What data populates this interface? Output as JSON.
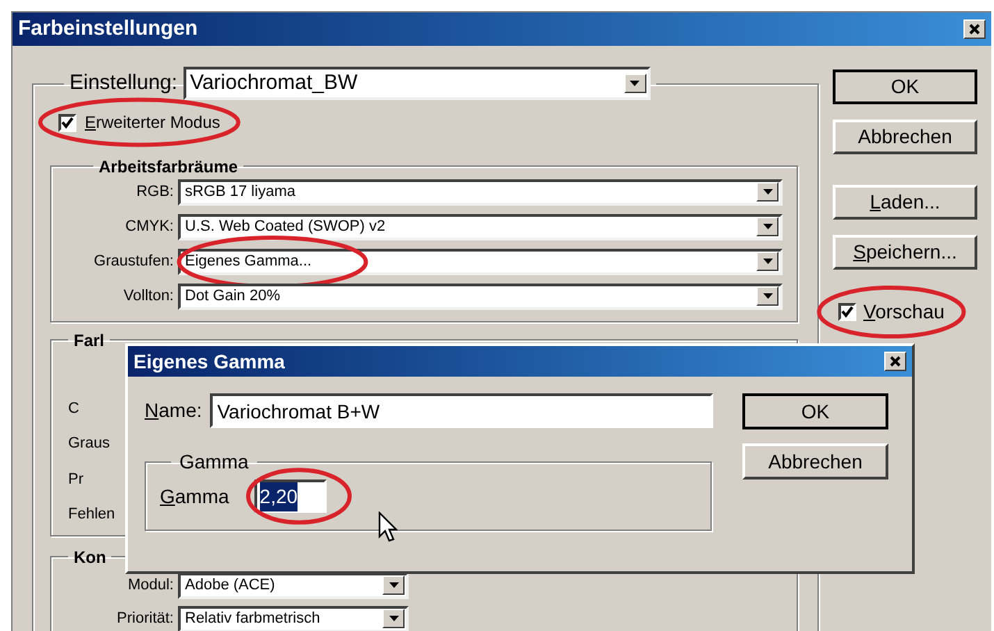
{
  "window": {
    "title": "Farbeinstellungen"
  },
  "setting": {
    "label": "Einstellung:",
    "value": "Variochromat_BW"
  },
  "advanced_mode": {
    "label": "Erweiterter Modus",
    "checked": true,
    "access_key": true,
    "highlighted": true
  },
  "working_spaces": {
    "title": "Arbeitsfarbräume",
    "rows": [
      {
        "label": "RGB:",
        "value": "sRGB 17 liyama",
        "highlighted": false
      },
      {
        "label": "CMYK:",
        "value": "U.S. Web Coated (SWOP) v2",
        "highlighted": false
      },
      {
        "label": "Graustufen:",
        "value": "Eigenes Gamma...",
        "highlighted": true
      },
      {
        "label": "Vollton:",
        "value": "Dot Gain 20%",
        "highlighted": false
      }
    ]
  },
  "color_management_policies": {
    "title": "Farl",
    "labels": [
      "C",
      "Graus",
      "Pr",
      "Fehlen"
    ]
  },
  "conversion_options": {
    "title": "Kon",
    "rows": [
      {
        "label": "Modul:",
        "value": "Adobe (ACE)"
      },
      {
        "label": "Priorität:",
        "value": "Relativ farbmetrisch"
      }
    ]
  },
  "buttons": [
    {
      "label": "OK",
      "default": true,
      "access_key": false
    },
    {
      "label": "Abbrechen",
      "default": false,
      "access_key": false
    },
    {
      "label": "Laden...",
      "default": false,
      "access_key": true
    },
    {
      "label": "Speichern...",
      "default": false,
      "access_key": true
    }
  ],
  "preview": {
    "label": "Vorschau",
    "checked": true,
    "access_key": true,
    "highlighted": true
  },
  "dialog": {
    "title": "Eigenes Gamma",
    "name": {
      "label": "Name:",
      "value": "Variochromat B+W",
      "access_key": true
    },
    "gamma_group": {
      "title": "Gamma",
      "label": "Gamma",
      "value": "2,20",
      "access_key": true,
      "text_selected": true,
      "highlighted": true
    },
    "buttons": [
      {
        "label": "OK",
        "default": true
      },
      {
        "label": "Abbrechen",
        "default": false
      }
    ]
  }
}
